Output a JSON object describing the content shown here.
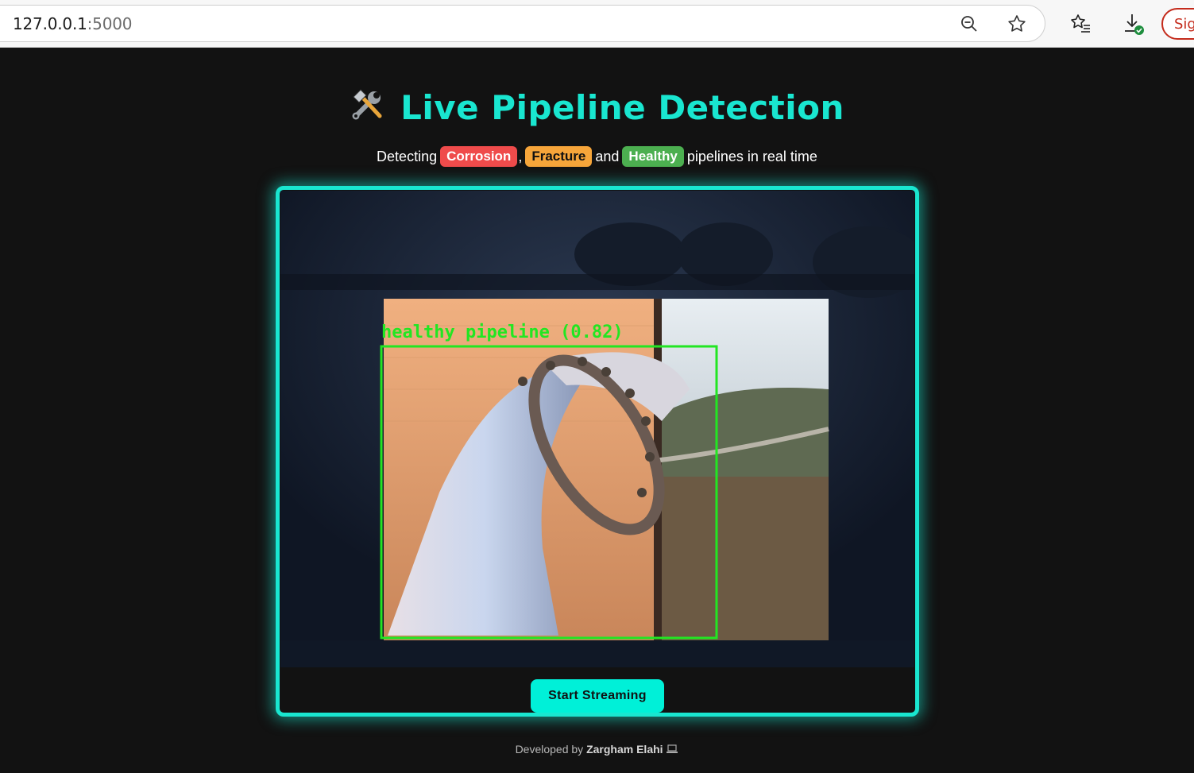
{
  "browser": {
    "url_host": "127.0.0.1",
    "url_port": ":5000",
    "signin_label": "Sig"
  },
  "header": {
    "title": "Live Pipeline Detection",
    "title_icon": "hammer-and-wrench-icon"
  },
  "subtitle": {
    "prefix": "Detecting",
    "badge_corrosion": "Corrosion",
    "sep1": ",",
    "badge_fracture": "Fracture",
    "and": "and",
    "badge_healthy": "Healthy",
    "suffix": "pipelines in real time"
  },
  "detection": {
    "label": "healthy pipeline (0.82)",
    "color": "#22e622"
  },
  "controls": {
    "start_label": "Start Streaming"
  },
  "footer": {
    "prefix": "Developed by",
    "author": "Zargham Elahi",
    "icon": "laptop-icon"
  },
  "colors": {
    "accent": "#19e6d0",
    "corrosion": "#ef4b4b",
    "fracture": "#f6a53a",
    "healthy": "#4caf50"
  }
}
